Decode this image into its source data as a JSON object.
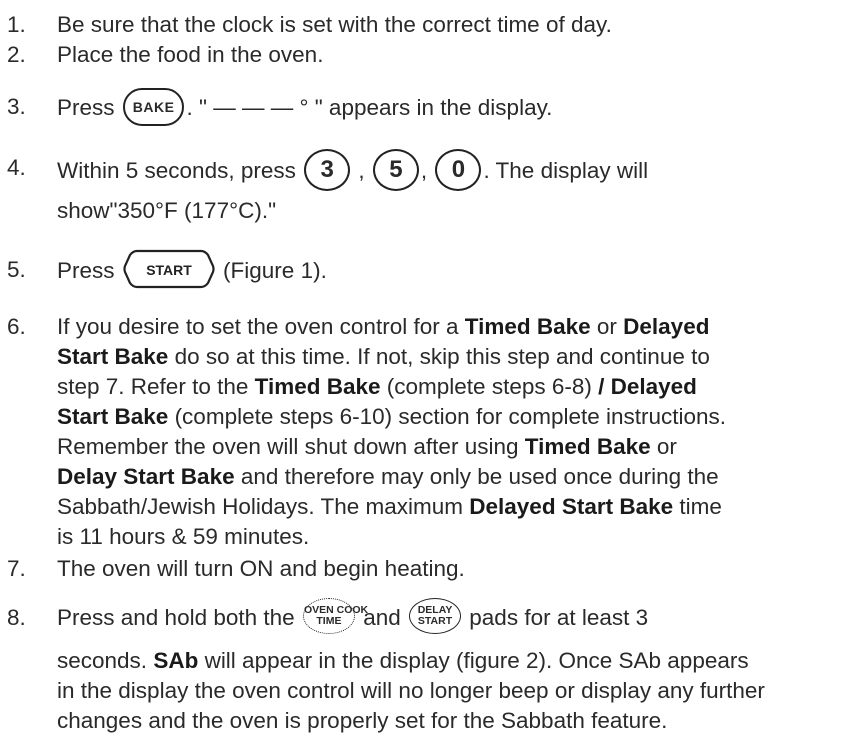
{
  "steps": [
    {
      "num": "1.",
      "text": "Be sure that the clock is set with the correct time of day."
    },
    {
      "num": "2.",
      "text": "Place the food in the oven."
    },
    {
      "num": "3.",
      "pre": "Press",
      "post": ". \" — — — ° \" appears in the display."
    },
    {
      "num": "4.",
      "pre": "Within 5 seconds, press",
      "sep1": ",",
      "sep2": ",",
      "post": ". The display will",
      "line2": "show\"350°F (177°C).\""
    },
    {
      "num": "5.",
      "pre": "Press",
      "post": "(Figure 1)."
    },
    {
      "num": "6.",
      "l1a": "If you desire to set the oven control for a ",
      "l1b": "Timed Bake",
      "l1c": " or ",
      "l1d": "Delayed",
      "l2a": "Start Bake",
      "l2b": " do so at this time. If not, skip this step and continue to",
      "l3a": "step 7. Refer to the ",
      "l3b": "Timed Bake",
      "l3c": " (complete steps 6-8) ",
      "l3d": "/ Delayed",
      "l4a": "Start Bake",
      "l4b": " (complete steps 6-10) section for complete instructions.",
      "l5a": "Remember the oven will shut down after using ",
      "l5b": "Timed Bake",
      "l5c": " or",
      "l6a": "Delay Start Bake",
      "l6b": " and therefore may only be used once during the",
      "l7a": "Sabbath/Jewish Holidays. The maximum ",
      "l7b": "Delayed Start Bake",
      "l7c": " time",
      "l8a": "is 11 hours & 59 minutes."
    },
    {
      "num": "7.",
      "text": "The oven will turn ON and begin heating."
    },
    {
      "num": "8.",
      "pre": "Press and hold both the",
      "mid": "and",
      "post": "pads for at least 3",
      "l2a": "seconds. ",
      "l2b": "SAb",
      "l2c": " will appear in the display (figure 2). Once SAb appears",
      "l3": "in the display the oven control will no longer beep or display any further",
      "l4": "changes and the oven is properly set for the Sabbath feature."
    }
  ],
  "keys": {
    "bake": "BAKE",
    "three": "3",
    "five": "5",
    "zero": "0",
    "start": "START",
    "oven_cook_time_line1": "OVEN COOK",
    "oven_cook_time_line2": "TIME",
    "delay_start_line1": "DELAY",
    "delay_start_line2": "START"
  }
}
